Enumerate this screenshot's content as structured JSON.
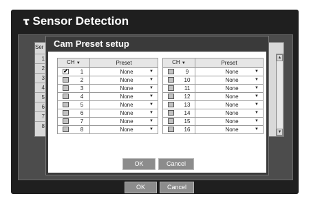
{
  "page": {
    "title": "Sensor Detection",
    "title_icon": "camera-icon",
    "colors": {
      "background": "#1f1f1f",
      "panel": "#4c4c4c",
      "dialog": "#3a3a3a",
      "button": "#8c8c8c"
    }
  },
  "background_table": {
    "tab_label": "Sen",
    "rows": [
      "1",
      "2",
      "3",
      "4",
      "5",
      "6",
      "7",
      "8"
    ]
  },
  "footer": {
    "ok_label": "OK",
    "cancel_label": "Cancel"
  },
  "dialog": {
    "title": "Cam Preset setup",
    "headers": {
      "ch": "CH",
      "preset": "Preset"
    },
    "dropdown_icon": "chevron-down-icon",
    "left_rows": [
      {
        "ch": "1",
        "preset": "None",
        "checked": true
      },
      {
        "ch": "2",
        "preset": "None",
        "checked": false
      },
      {
        "ch": "3",
        "preset": "None",
        "checked": false
      },
      {
        "ch": "4",
        "preset": "None",
        "checked": false
      },
      {
        "ch": "5",
        "preset": "None",
        "checked": false
      },
      {
        "ch": "6",
        "preset": "None",
        "checked": false
      },
      {
        "ch": "7",
        "preset": "None",
        "checked": false
      },
      {
        "ch": "8",
        "preset": "None",
        "checked": false
      }
    ],
    "right_rows": [
      {
        "ch": "9",
        "preset": "None",
        "checked": false
      },
      {
        "ch": "10",
        "preset": "None",
        "checked": false
      },
      {
        "ch": "11",
        "preset": "None",
        "checked": false
      },
      {
        "ch": "12",
        "preset": "None",
        "checked": false
      },
      {
        "ch": "13",
        "preset": "None",
        "checked": false
      },
      {
        "ch": "14",
        "preset": "None",
        "checked": false
      },
      {
        "ch": "15",
        "preset": "None",
        "checked": false
      },
      {
        "ch": "16",
        "preset": "None",
        "checked": false
      }
    ],
    "ok_label": "OK",
    "cancel_label": "Cancel"
  }
}
